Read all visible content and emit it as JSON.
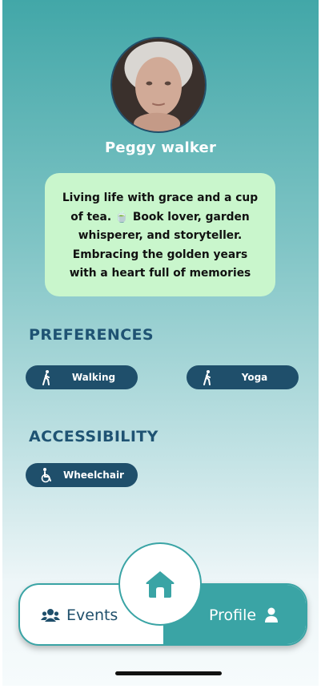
{
  "profile": {
    "name": "Peggy walker",
    "bio": "Living life with grace and a cup of tea. 🍵 Book lover, garden whisperer, and storyteller. Embracing the golden years with a heart full of memories"
  },
  "preferences": {
    "title": "PREFERENCES",
    "items": [
      {
        "label": "Walking",
        "icon": "walking-icon"
      },
      {
        "label": "Yoga",
        "icon": "walking-icon"
      }
    ]
  },
  "accessibility": {
    "title": "ACCESSIBILITY",
    "items": [
      {
        "label": "Wheelchair",
        "icon": "wheelchair-icon"
      }
    ]
  },
  "nav": {
    "events_label": "Events",
    "profile_label": "Profile",
    "home_icon": "home-icon"
  },
  "colors": {
    "teal": "#3aa4a5",
    "navy": "#1f4f6b",
    "bio_bg": "#c9f6cc"
  }
}
